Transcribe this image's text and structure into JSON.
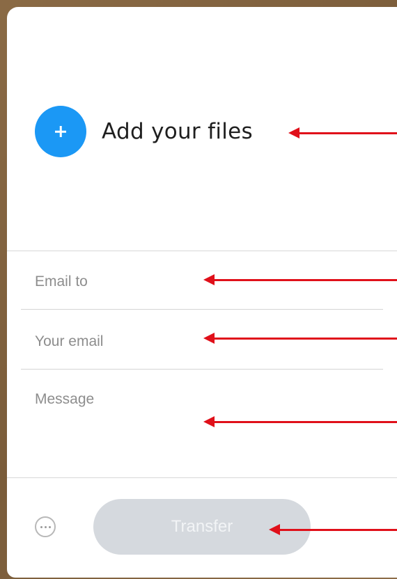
{
  "upload": {
    "title": "Add your files",
    "icon": "plus-icon",
    "accent_color": "#1b98f5"
  },
  "form": {
    "email_to_placeholder": "Email to",
    "your_email_placeholder": "Your email",
    "message_placeholder": "Message",
    "email_to_value": "",
    "your_email_value": "",
    "message_value": ""
  },
  "footer": {
    "more_icon": "more-options-icon",
    "transfer_label": "Transfer",
    "transfer_enabled": false
  },
  "annotations": {
    "arrow_color": "#e0101a"
  }
}
